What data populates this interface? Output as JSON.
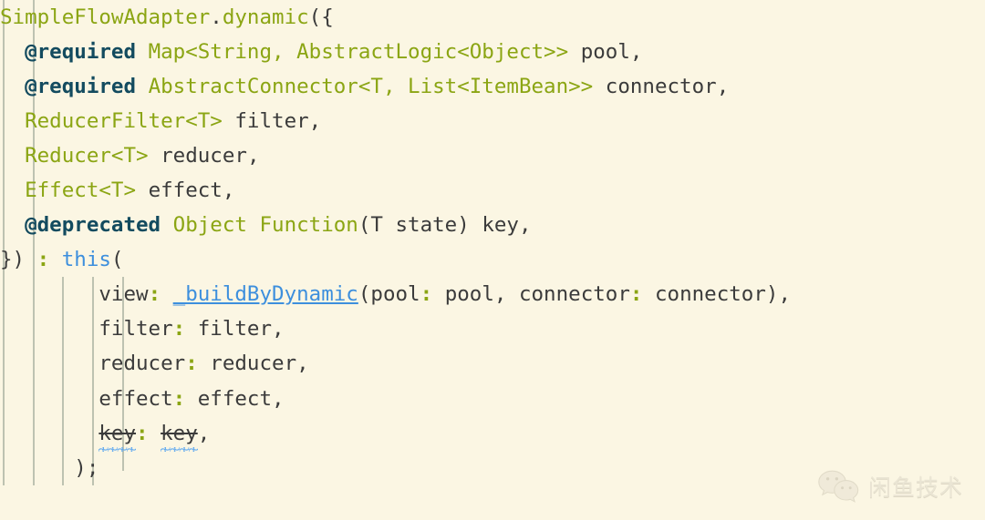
{
  "editor": {
    "language": "dart",
    "background_color": "#fbf6e3",
    "colors": {
      "type": "#8ba513",
      "annotation": "#134b5f",
      "keyword": "#3d8fdd",
      "function": "#3d8fdd",
      "identifier": "#3b3b3b",
      "named_arg_colon": "#8ba513",
      "squiggle": "#5fa8ef",
      "indent_guide": "#b9bfae"
    },
    "indent_guides_x": [
      3,
      36,
      68,
      101,
      134,
      166,
      199
    ],
    "lines": [
      {
        "n": 1,
        "indent": 0,
        "tokens": [
          {
            "t": "SimpleFlowAdapter",
            "c": "t-type"
          },
          {
            "t": ".",
            "c": "t-punc"
          },
          {
            "t": "dynamic",
            "c": "t-type"
          },
          {
            "t": "({",
            "c": "t-punc"
          }
        ]
      },
      {
        "n": 2,
        "indent": 0,
        "tokens": [
          {
            "t": "  ",
            "c": "t-punc"
          },
          {
            "t": "@required",
            "c": "t-ann"
          },
          {
            "t": " ",
            "c": "t-punc"
          },
          {
            "t": "Map<String, AbstractLogic<Object>>",
            "c": "t-type"
          },
          {
            "t": " ",
            "c": "t-punc"
          },
          {
            "t": "pool",
            "c": "t-id"
          },
          {
            "t": ",",
            "c": "t-punc"
          }
        ]
      },
      {
        "n": 3,
        "indent": 0,
        "tokens": [
          {
            "t": "  ",
            "c": "t-punc"
          },
          {
            "t": "@required",
            "c": "t-ann"
          },
          {
            "t": " ",
            "c": "t-punc"
          },
          {
            "t": "AbstractConnector<T, List<ItemBean>>",
            "c": "t-type"
          },
          {
            "t": " ",
            "c": "t-punc"
          },
          {
            "t": "connector",
            "c": "t-id"
          },
          {
            "t": ",",
            "c": "t-punc"
          }
        ]
      },
      {
        "n": 4,
        "indent": 0,
        "tokens": [
          {
            "t": "  ",
            "c": "t-punc"
          },
          {
            "t": "ReducerFilter<T>",
            "c": "t-type"
          },
          {
            "t": " ",
            "c": "t-punc"
          },
          {
            "t": "filter",
            "c": "t-id"
          },
          {
            "t": ",",
            "c": "t-punc"
          }
        ]
      },
      {
        "n": 5,
        "indent": 0,
        "tokens": [
          {
            "t": "  ",
            "c": "t-punc"
          },
          {
            "t": "Reducer<T>",
            "c": "t-type"
          },
          {
            "t": " ",
            "c": "t-punc"
          },
          {
            "t": "reducer",
            "c": "t-id"
          },
          {
            "t": ",",
            "c": "t-punc"
          }
        ]
      },
      {
        "n": 6,
        "indent": 0,
        "tokens": [
          {
            "t": "  ",
            "c": "t-punc"
          },
          {
            "t": "Effect<T>",
            "c": "t-type"
          },
          {
            "t": " ",
            "c": "t-punc"
          },
          {
            "t": "effect",
            "c": "t-id"
          },
          {
            "t": ",",
            "c": "t-punc"
          }
        ]
      },
      {
        "n": 7,
        "indent": 0,
        "tokens": [
          {
            "t": "  ",
            "c": "t-punc"
          },
          {
            "t": "@deprecated",
            "c": "t-ann"
          },
          {
            "t": " ",
            "c": "t-punc"
          },
          {
            "t": "Object Function",
            "c": "t-type"
          },
          {
            "t": "(T ",
            "c": "t-punc"
          },
          {
            "t": "state",
            "c": "t-id"
          },
          {
            "t": ") ",
            "c": "t-punc"
          },
          {
            "t": "key",
            "c": "t-id"
          },
          {
            "t": ",",
            "c": "t-punc"
          }
        ]
      },
      {
        "n": 8,
        "indent": 0,
        "tokens": [
          {
            "t": "}) ",
            "c": "t-punc"
          },
          {
            "t": ":",
            "c": "t-colon"
          },
          {
            "t": " ",
            "c": "t-punc"
          },
          {
            "t": "this",
            "c": "t-kw"
          },
          {
            "t": "(",
            "c": "t-punc"
          }
        ]
      },
      {
        "n": 9,
        "indent": 0,
        "tokens": [
          {
            "t": "        ",
            "c": "t-punc"
          },
          {
            "t": "view",
            "c": "t-id"
          },
          {
            "t": ":",
            "c": "t-colon"
          },
          {
            "t": " ",
            "c": "t-punc"
          },
          {
            "t": "_buildByDynamic",
            "c": "t-fn"
          },
          {
            "t": "(",
            "c": "t-punc"
          },
          {
            "t": "pool",
            "c": "t-id"
          },
          {
            "t": ":",
            "c": "t-colon"
          },
          {
            "t": " ",
            "c": "t-punc"
          },
          {
            "t": "pool",
            "c": "t-id"
          },
          {
            "t": ", ",
            "c": "t-punc"
          },
          {
            "t": "connector",
            "c": "t-id"
          },
          {
            "t": ":",
            "c": "t-colon"
          },
          {
            "t": " ",
            "c": "t-punc"
          },
          {
            "t": "connector",
            "c": "t-id"
          },
          {
            "t": "),",
            "c": "t-punc"
          }
        ]
      },
      {
        "n": 10,
        "indent": 0,
        "tokens": [
          {
            "t": "        ",
            "c": "t-punc"
          },
          {
            "t": "filter",
            "c": "t-id"
          },
          {
            "t": ":",
            "c": "t-colon"
          },
          {
            "t": " ",
            "c": "t-punc"
          },
          {
            "t": "filter",
            "c": "t-id"
          },
          {
            "t": ",",
            "c": "t-punc"
          }
        ]
      },
      {
        "n": 11,
        "indent": 0,
        "tokens": [
          {
            "t": "        ",
            "c": "t-punc"
          },
          {
            "t": "reducer",
            "c": "t-id"
          },
          {
            "t": ":",
            "c": "t-colon"
          },
          {
            "t": " ",
            "c": "t-punc"
          },
          {
            "t": "reducer",
            "c": "t-id"
          },
          {
            "t": ",",
            "c": "t-punc"
          }
        ]
      },
      {
        "n": 12,
        "indent": 0,
        "tokens": [
          {
            "t": "        ",
            "c": "t-punc"
          },
          {
            "t": "effect",
            "c": "t-id"
          },
          {
            "t": ":",
            "c": "t-colon"
          },
          {
            "t": " ",
            "c": "t-punc"
          },
          {
            "t": "effect",
            "c": "t-id"
          },
          {
            "t": ",",
            "c": "t-punc"
          }
        ]
      },
      {
        "n": 13,
        "indent": 0,
        "tokens": [
          {
            "t": "        ",
            "c": "t-punc"
          },
          {
            "t": "key",
            "c": "t-dep squig"
          },
          {
            "t": ":",
            "c": "t-colon"
          },
          {
            "t": " ",
            "c": "t-punc"
          },
          {
            "t": "key",
            "c": "t-dep squig"
          },
          {
            "t": ",",
            "c": "t-punc"
          }
        ]
      },
      {
        "n": 14,
        "indent": 0,
        "tokens": [
          {
            "t": "      ",
            "c": "t-punc"
          },
          {
            "t": ");",
            "c": "t-punc"
          }
        ]
      }
    ],
    "plain_text": "SimpleFlowAdapter.dynamic({\n  @required Map<String, AbstractLogic<Object>> pool,\n  @required AbstractConnector<T, List<ItemBean>> connector,\n  ReducerFilter<T> filter,\n  Reducer<T> reducer,\n  Effect<T> effect,\n  @deprecated Object Function(T state) key,\n}) : this(\n        view: _buildByDynamic(pool: pool, connector: connector),\n        filter: filter,\n        reducer: reducer,\n        effect: effect,\n        key: key,\n      );"
  },
  "watermark": {
    "icon": "wechat-icon",
    "text": "闲鱼技术"
  }
}
